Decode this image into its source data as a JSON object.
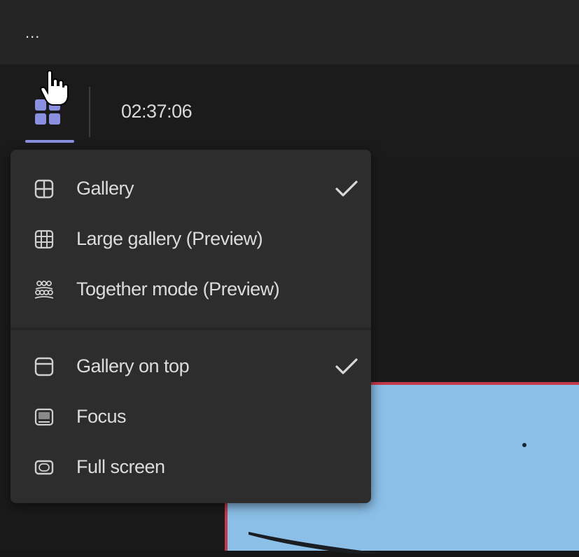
{
  "top_bar": {
    "more_label": "...",
    "more_icon": "more-horizontal-icon"
  },
  "toolbar": {
    "layout_icon": "grid-layout-icon",
    "timer": "02:37:06",
    "accent_color": "#8b8fe0"
  },
  "layout_menu": {
    "sections": [
      {
        "items": [
          {
            "label": "Gallery",
            "icon": "gallery-grid-icon",
            "checked": true
          },
          {
            "label": "Large gallery (Preview)",
            "icon": "large-gallery-icon",
            "checked": false
          },
          {
            "label": "Together mode (Preview)",
            "icon": "together-mode-icon",
            "checked": false
          }
        ]
      },
      {
        "items": [
          {
            "label": "Gallery on top",
            "icon": "gallery-on-top-icon",
            "checked": true
          },
          {
            "label": "Focus",
            "icon": "focus-icon",
            "checked": false
          },
          {
            "label": "Full screen",
            "icon": "full-screen-icon",
            "checked": false
          }
        ]
      }
    ]
  },
  "stage": {
    "video_color": "#8bbfe8",
    "video_border_color": "#c43a4a"
  }
}
